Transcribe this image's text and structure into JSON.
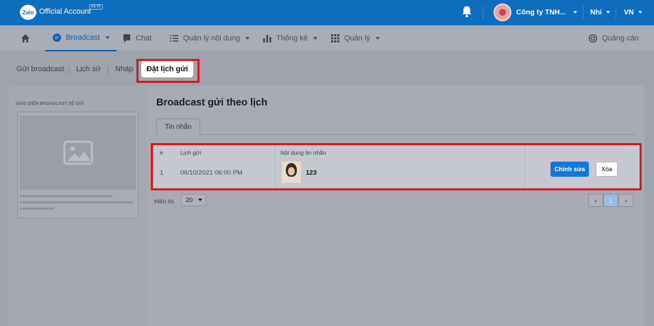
{
  "topbar": {
    "logo": "Zalo",
    "brand": "Official Account",
    "beta": "BETA",
    "company": "Công ty TNH...",
    "user": "Nhi",
    "lang": "VN"
  },
  "nav": {
    "home_icon": "home-icon",
    "broadcast": "Broadcast",
    "chat": "Chat",
    "content": "Quản lý nội dung",
    "stats": "Thống kê",
    "manage": "Quản lý",
    "ads": "Quảng cáo"
  },
  "subtabs": {
    "send": "Gửi broadcast",
    "history": "Lịch sử",
    "draft": "Nháp",
    "schedule": "Đặt lịch gửi"
  },
  "left": {
    "title": "GIAO DIỆN BROADCAST SẼ GỬI"
  },
  "main": {
    "title": "Broadcast gửi theo lịch",
    "tab": "Tin nhắn",
    "table": {
      "headers": {
        "index": "#",
        "schedule": "Lịch gửi",
        "content": "Nội dung tin nhắn"
      },
      "rows": [
        {
          "index": "1",
          "schedule": "06/10/2021 06:00 PM",
          "content": "123",
          "edit": "Chỉnh sửa",
          "delete": "Xóa"
        }
      ]
    },
    "show_label": "Hiển thị",
    "page_size": "20",
    "pager": {
      "prev": "‹",
      "current": "1",
      "next": "›"
    }
  },
  "colors": {
    "brand_blue": "#0e6dbd",
    "highlight_red": "#e0141c",
    "button_blue": "#1078d8"
  }
}
